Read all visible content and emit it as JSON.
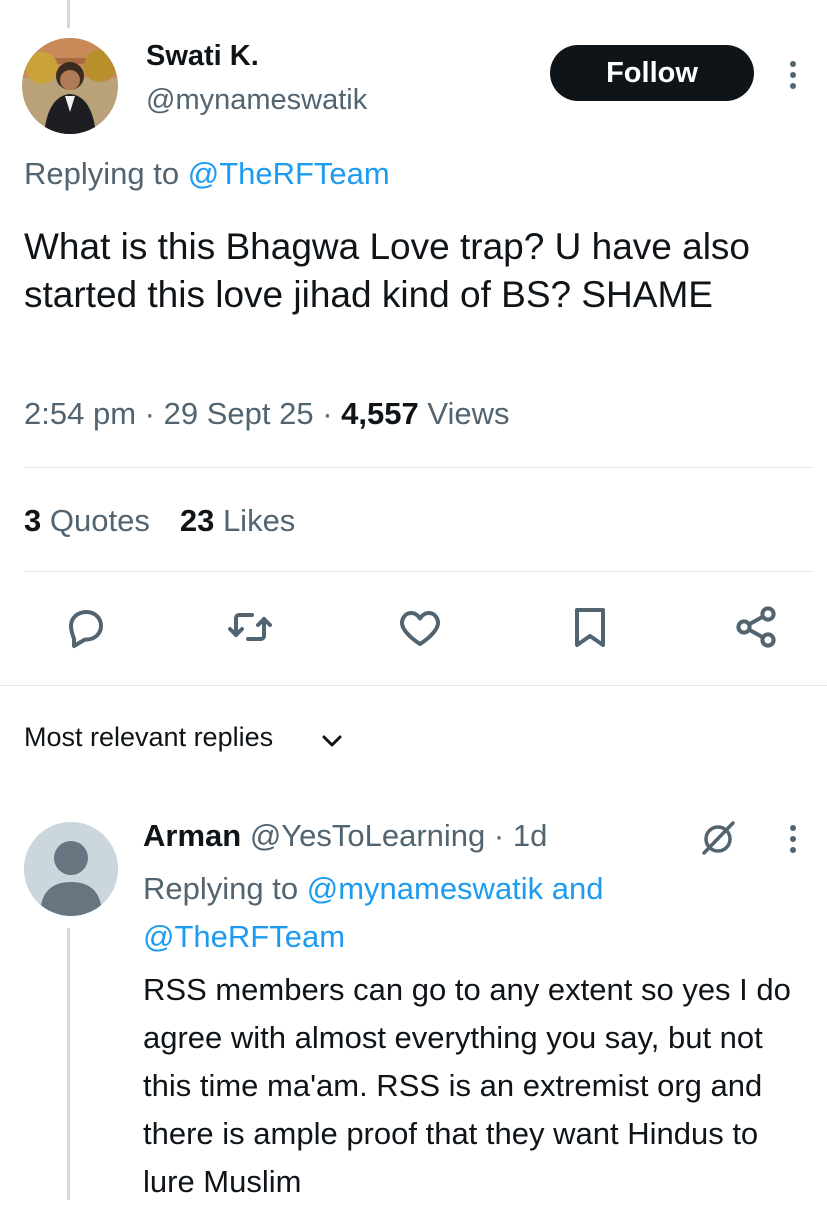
{
  "tweet": {
    "author_name": "Swati K.",
    "author_handle": "@mynameswatik",
    "follow_label": "Follow",
    "replying_prefix": "Replying to ",
    "replying_handle": "@TheRFTeam",
    "text": "What is this Bhagwa Love trap? U have also started this love jihad kind of BS? SHAME",
    "time": "2:54 pm",
    "date": "29 Sept 25",
    "views_count": "4,557",
    "views_label": "Views",
    "separator": "·",
    "quotes_count": "3",
    "quotes_label": "Quotes",
    "likes_count": "23",
    "likes_label": "Likes"
  },
  "actions": [
    {
      "icon": "reply-icon"
    },
    {
      "icon": "retweet-icon"
    },
    {
      "icon": "like-icon"
    },
    {
      "icon": "bookmark-icon"
    },
    {
      "icon": "share-icon"
    }
  ],
  "replies_section": {
    "title": "Most relevant replies"
  },
  "reply": {
    "author_name": "Arman",
    "author_handle": "@YesToLearning",
    "separator": "·",
    "age": "1d",
    "replying_prefix": "Replying to ",
    "replying_handle_1": "@mynameswatik",
    "replying_and": " and ",
    "replying_handle_2": "@TheRFTeam",
    "text": "RSS members can go to any extent so yes I do agree with almost everything you say, but not this time ma'am. RSS is an extremist org and there is ample proof that they want Hindus to lure Muslim"
  },
  "colors": {
    "link": "#1d9bf0",
    "secondary_text": "#536471",
    "primary_text": "#0f1419",
    "divider": "#e1e8ed",
    "follow_bg": "#0f1419"
  }
}
